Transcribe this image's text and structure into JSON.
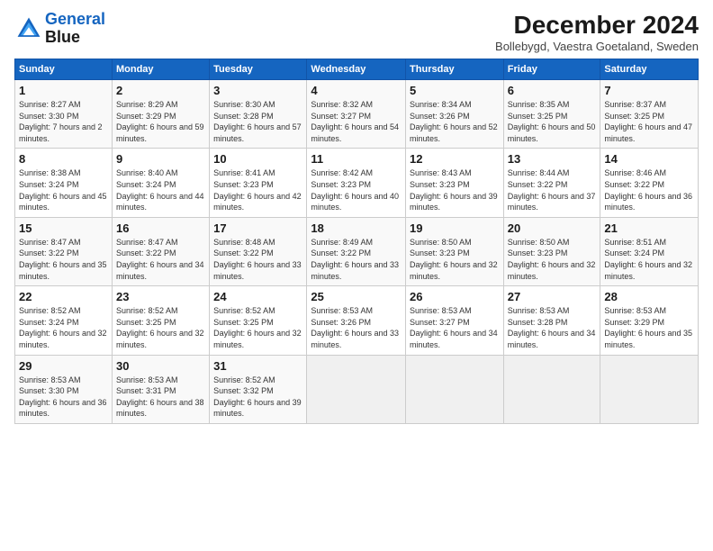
{
  "header": {
    "logo_line1": "General",
    "logo_line2": "Blue",
    "month_title": "December 2024",
    "subtitle": "Bollebygd, Vaestra Goetaland, Sweden"
  },
  "days_of_week": [
    "Sunday",
    "Monday",
    "Tuesday",
    "Wednesday",
    "Thursday",
    "Friday",
    "Saturday"
  ],
  "weeks": [
    [
      {
        "day": "1",
        "sunrise": "Sunrise: 8:27 AM",
        "sunset": "Sunset: 3:30 PM",
        "daylight": "Daylight: 7 hours and 2 minutes."
      },
      {
        "day": "2",
        "sunrise": "Sunrise: 8:29 AM",
        "sunset": "Sunset: 3:29 PM",
        "daylight": "Daylight: 6 hours and 59 minutes."
      },
      {
        "day": "3",
        "sunrise": "Sunrise: 8:30 AM",
        "sunset": "Sunset: 3:28 PM",
        "daylight": "Daylight: 6 hours and 57 minutes."
      },
      {
        "day": "4",
        "sunrise": "Sunrise: 8:32 AM",
        "sunset": "Sunset: 3:27 PM",
        "daylight": "Daylight: 6 hours and 54 minutes."
      },
      {
        "day": "5",
        "sunrise": "Sunrise: 8:34 AM",
        "sunset": "Sunset: 3:26 PM",
        "daylight": "Daylight: 6 hours and 52 minutes."
      },
      {
        "day": "6",
        "sunrise": "Sunrise: 8:35 AM",
        "sunset": "Sunset: 3:25 PM",
        "daylight": "Daylight: 6 hours and 50 minutes."
      },
      {
        "day": "7",
        "sunrise": "Sunrise: 8:37 AM",
        "sunset": "Sunset: 3:25 PM",
        "daylight": "Daylight: 6 hours and 47 minutes."
      }
    ],
    [
      {
        "day": "8",
        "sunrise": "Sunrise: 8:38 AM",
        "sunset": "Sunset: 3:24 PM",
        "daylight": "Daylight: 6 hours and 45 minutes."
      },
      {
        "day": "9",
        "sunrise": "Sunrise: 8:40 AM",
        "sunset": "Sunset: 3:24 PM",
        "daylight": "Daylight: 6 hours and 44 minutes."
      },
      {
        "day": "10",
        "sunrise": "Sunrise: 8:41 AM",
        "sunset": "Sunset: 3:23 PM",
        "daylight": "Daylight: 6 hours and 42 minutes."
      },
      {
        "day": "11",
        "sunrise": "Sunrise: 8:42 AM",
        "sunset": "Sunset: 3:23 PM",
        "daylight": "Daylight: 6 hours and 40 minutes."
      },
      {
        "day": "12",
        "sunrise": "Sunrise: 8:43 AM",
        "sunset": "Sunset: 3:23 PM",
        "daylight": "Daylight: 6 hours and 39 minutes."
      },
      {
        "day": "13",
        "sunrise": "Sunrise: 8:44 AM",
        "sunset": "Sunset: 3:22 PM",
        "daylight": "Daylight: 6 hours and 37 minutes."
      },
      {
        "day": "14",
        "sunrise": "Sunrise: 8:46 AM",
        "sunset": "Sunset: 3:22 PM",
        "daylight": "Daylight: 6 hours and 36 minutes."
      }
    ],
    [
      {
        "day": "15",
        "sunrise": "Sunrise: 8:47 AM",
        "sunset": "Sunset: 3:22 PM",
        "daylight": "Daylight: 6 hours and 35 minutes."
      },
      {
        "day": "16",
        "sunrise": "Sunrise: 8:47 AM",
        "sunset": "Sunset: 3:22 PM",
        "daylight": "Daylight: 6 hours and 34 minutes."
      },
      {
        "day": "17",
        "sunrise": "Sunrise: 8:48 AM",
        "sunset": "Sunset: 3:22 PM",
        "daylight": "Daylight: 6 hours and 33 minutes."
      },
      {
        "day": "18",
        "sunrise": "Sunrise: 8:49 AM",
        "sunset": "Sunset: 3:22 PM",
        "daylight": "Daylight: 6 hours and 33 minutes."
      },
      {
        "day": "19",
        "sunrise": "Sunrise: 8:50 AM",
        "sunset": "Sunset: 3:23 PM",
        "daylight": "Daylight: 6 hours and 32 minutes."
      },
      {
        "day": "20",
        "sunrise": "Sunrise: 8:50 AM",
        "sunset": "Sunset: 3:23 PM",
        "daylight": "Daylight: 6 hours and 32 minutes."
      },
      {
        "day": "21",
        "sunrise": "Sunrise: 8:51 AM",
        "sunset": "Sunset: 3:24 PM",
        "daylight": "Daylight: 6 hours and 32 minutes."
      }
    ],
    [
      {
        "day": "22",
        "sunrise": "Sunrise: 8:52 AM",
        "sunset": "Sunset: 3:24 PM",
        "daylight": "Daylight: 6 hours and 32 minutes."
      },
      {
        "day": "23",
        "sunrise": "Sunrise: 8:52 AM",
        "sunset": "Sunset: 3:25 PM",
        "daylight": "Daylight: 6 hours and 32 minutes."
      },
      {
        "day": "24",
        "sunrise": "Sunrise: 8:52 AM",
        "sunset": "Sunset: 3:25 PM",
        "daylight": "Daylight: 6 hours and 32 minutes."
      },
      {
        "day": "25",
        "sunrise": "Sunrise: 8:53 AM",
        "sunset": "Sunset: 3:26 PM",
        "daylight": "Daylight: 6 hours and 33 minutes."
      },
      {
        "day": "26",
        "sunrise": "Sunrise: 8:53 AM",
        "sunset": "Sunset: 3:27 PM",
        "daylight": "Daylight: 6 hours and 34 minutes."
      },
      {
        "day": "27",
        "sunrise": "Sunrise: 8:53 AM",
        "sunset": "Sunset: 3:28 PM",
        "daylight": "Daylight: 6 hours and 34 minutes."
      },
      {
        "day": "28",
        "sunrise": "Sunrise: 8:53 AM",
        "sunset": "Sunset: 3:29 PM",
        "daylight": "Daylight: 6 hours and 35 minutes."
      }
    ],
    [
      {
        "day": "29",
        "sunrise": "Sunrise: 8:53 AM",
        "sunset": "Sunset: 3:30 PM",
        "daylight": "Daylight: 6 hours and 36 minutes."
      },
      {
        "day": "30",
        "sunrise": "Sunrise: 8:53 AM",
        "sunset": "Sunset: 3:31 PM",
        "daylight": "Daylight: 6 hours and 38 minutes."
      },
      {
        "day": "31",
        "sunrise": "Sunrise: 8:52 AM",
        "sunset": "Sunset: 3:32 PM",
        "daylight": "Daylight: 6 hours and 39 minutes."
      },
      null,
      null,
      null,
      null
    ]
  ]
}
